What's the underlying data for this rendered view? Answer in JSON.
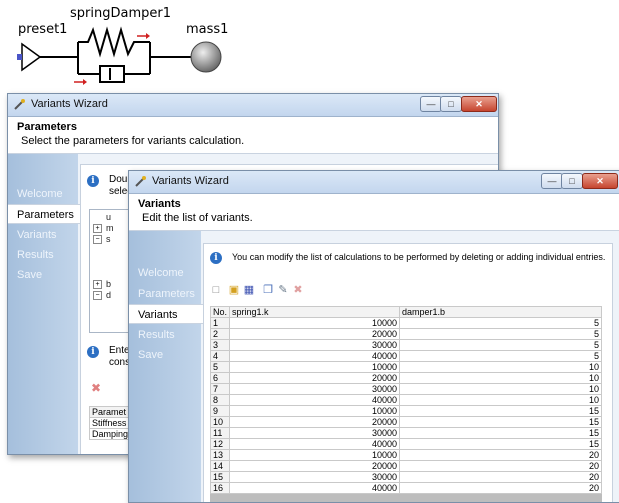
{
  "diagram": {
    "component_name": "springDamper1",
    "left_label": "preset1",
    "right_label": "mass1"
  },
  "back_window": {
    "title": "Variants Wizard",
    "header_title": "Parameters",
    "header_desc": "Select the parameters for variants calculation.",
    "nav": [
      "Welcome",
      "Parameters",
      "Variants",
      "Results",
      "Save"
    ],
    "active_nav": "Parameters",
    "info_text_1": "Doubl",
    "info_text_1b": "selec",
    "info_text_2": "Enter",
    "info_text_2b": "const",
    "tree": [
      "u",
      "m",
      "s",
      "",
      "",
      "",
      "b",
      "d",
      "",
      "",
      ""
    ],
    "param_table": {
      "header": "Paramet",
      "rows": [
        "Stiffness",
        "Damping"
      ]
    }
  },
  "front_window": {
    "title": "Variants Wizard",
    "header_title": "Variants",
    "header_desc": "Edit the list of variants.",
    "nav": [
      "Welcome",
      "Parameters",
      "Variants",
      "Results",
      "Save"
    ],
    "active_nav": "Variants",
    "info_text": "You can modify the list of calculations to be performed by deleting or adding individual entries.",
    "table": {
      "columns": [
        "No.",
        "spring1.k",
        "damper1.b"
      ],
      "rows": [
        [
          "1",
          "10000",
          "5"
        ],
        [
          "2",
          "20000",
          "5"
        ],
        [
          "3",
          "30000",
          "5"
        ],
        [
          "4",
          "40000",
          "5"
        ],
        [
          "5",
          "10000",
          "10"
        ],
        [
          "6",
          "20000",
          "10"
        ],
        [
          "7",
          "30000",
          "10"
        ],
        [
          "8",
          "40000",
          "10"
        ],
        [
          "9",
          "10000",
          "15"
        ],
        [
          "10",
          "20000",
          "15"
        ],
        [
          "11",
          "30000",
          "15"
        ],
        [
          "12",
          "40000",
          "15"
        ],
        [
          "13",
          "10000",
          "20"
        ],
        [
          "14",
          "20000",
          "20"
        ],
        [
          "15",
          "30000",
          "20"
        ],
        [
          "16",
          "40000",
          "20"
        ]
      ]
    }
  },
  "colors": {
    "sidebar": "#a5bfdc",
    "titlebar": "#c3d6ee",
    "close_button": "#c6452f",
    "mass_ball": "#8a8a8a",
    "connector": "#4a55c8",
    "arrow": "#d02020"
  }
}
